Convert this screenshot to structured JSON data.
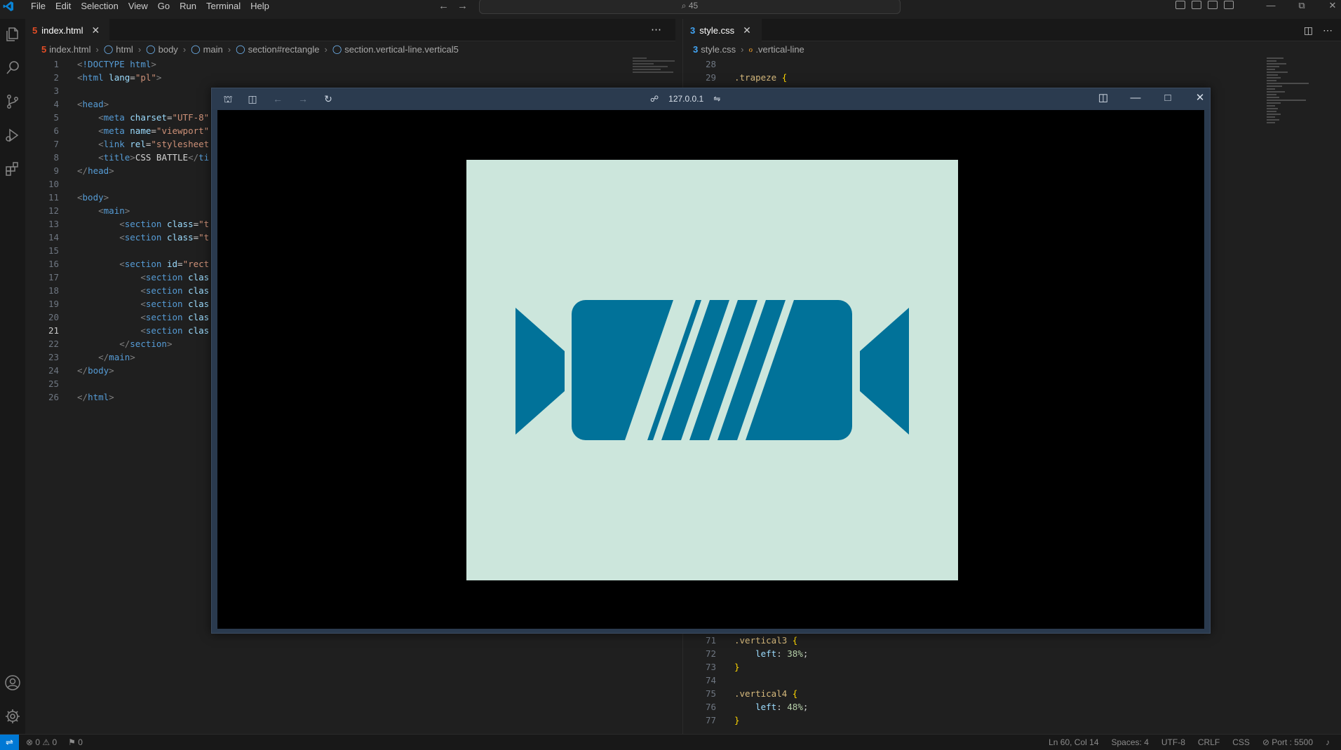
{
  "menu": [
    "File",
    "Edit",
    "Selection",
    "View",
    "Go",
    "Run",
    "Terminal",
    "Help"
  ],
  "command_center": "⌕ 45",
  "left_tab": {
    "label": "index.html"
  },
  "left_breadcrumb": [
    "index.html",
    "html",
    "body",
    "main",
    "section#rectangle",
    "section.vertical-line.vertical5"
  ],
  "left_code": [
    {
      "n": "1",
      "html": "<span class=\"punc\">&lt;</span><span class=\"tag\">!DOCTYPE html</span><span class=\"punc\">&gt;</span>"
    },
    {
      "n": "2",
      "html": "<span class=\"punc\">&lt;</span><span class=\"tag\">html</span> <span class=\"attr\">lang</span>=<span class=\"str\">\"pl\"</span><span class=\"punc\">&gt;</span>"
    },
    {
      "n": "3",
      "html": ""
    },
    {
      "n": "4",
      "html": "<span class=\"punc\">&lt;</span><span class=\"tag\">head</span><span class=\"punc\">&gt;</span>"
    },
    {
      "n": "5",
      "html": "    <span class=\"punc\">&lt;</span><span class=\"tag\">meta</span> <span class=\"attr\">charset</span>=<span class=\"str\">\"UTF-8\"</span>"
    },
    {
      "n": "6",
      "html": "    <span class=\"punc\">&lt;</span><span class=\"tag\">meta</span> <span class=\"attr\">name</span>=<span class=\"str\">\"viewport\"</span>"
    },
    {
      "n": "7",
      "html": "    <span class=\"punc\">&lt;</span><span class=\"tag\">link</span> <span class=\"attr\">rel</span>=<span class=\"str\">\"stylesheet</span>"
    },
    {
      "n": "8",
      "html": "    <span class=\"punc\">&lt;</span><span class=\"tag\">title</span><span class=\"punc\">&gt;</span><span class=\"txt\">CSS BATTLE</span><span class=\"punc\">&lt;/</span><span class=\"tag\">ti</span>"
    },
    {
      "n": "9",
      "html": "<span class=\"punc\">&lt;/</span><span class=\"tag\">head</span><span class=\"punc\">&gt;</span>"
    },
    {
      "n": "10",
      "html": ""
    },
    {
      "n": "11",
      "html": "<span class=\"punc\">&lt;</span><span class=\"tag\">body</span><span class=\"punc\">&gt;</span>"
    },
    {
      "n": "12",
      "html": "    <span class=\"punc\">&lt;</span><span class=\"tag\">main</span><span class=\"punc\">&gt;</span>"
    },
    {
      "n": "13",
      "html": "        <span class=\"punc\">&lt;</span><span class=\"tag\">section</span> <span class=\"attr\">class</span>=<span class=\"str\">\"t</span>"
    },
    {
      "n": "14",
      "html": "        <span class=\"punc\">&lt;</span><span class=\"tag\">section</span> <span class=\"attr\">class</span>=<span class=\"str\">\"t</span>"
    },
    {
      "n": "15",
      "html": ""
    },
    {
      "n": "16",
      "html": "        <span class=\"punc\">&lt;</span><span class=\"tag\">section</span> <span class=\"attr\">id</span>=<span class=\"str\">\"rect</span>"
    },
    {
      "n": "17",
      "html": "            <span class=\"punc\">&lt;</span><span class=\"tag\">section</span> <span class=\"attr\">clas</span>"
    },
    {
      "n": "18",
      "html": "            <span class=\"punc\">&lt;</span><span class=\"tag\">section</span> <span class=\"attr\">clas</span>"
    },
    {
      "n": "19",
      "html": "            <span class=\"punc\">&lt;</span><span class=\"tag\">section</span> <span class=\"attr\">clas</span>"
    },
    {
      "n": "20",
      "html": "            <span class=\"punc\">&lt;</span><span class=\"tag\">section</span> <span class=\"attr\">clas</span>"
    },
    {
      "n": "21",
      "html": "            <span class=\"punc\">&lt;</span><span class=\"tag\">section</span> <span class=\"attr\">clas</span>",
      "active": true
    },
    {
      "n": "22",
      "html": "        <span class=\"punc\">&lt;/</span><span class=\"tag\">section</span><span class=\"punc\">&gt;</span>"
    },
    {
      "n": "23",
      "html": "    <span class=\"punc\">&lt;/</span><span class=\"tag\">main</span><span class=\"punc\">&gt;</span>"
    },
    {
      "n": "24",
      "html": "<span class=\"punc\">&lt;/</span><span class=\"tag\">body</span><span class=\"punc\">&gt;</span>"
    },
    {
      "n": "25",
      "html": ""
    },
    {
      "n": "26",
      "html": "<span class=\"punc\">&lt;/</span><span class=\"tag\">html</span><span class=\"punc\">&gt;</span>"
    }
  ],
  "right_tab": {
    "label": "style.css"
  },
  "right_breadcrumb": [
    "style.css",
    ".vertical-line"
  ],
  "right_code_top": [
    {
      "n": "28",
      "html": ""
    },
    {
      "n": "29",
      "html": "<span class=\"sel\">.trapeze</span> <span class=\"brace\">{</span>"
    }
  ],
  "right_code_bottom": [
    {
      "n": "71",
      "html": "<span class=\"sel\">.vertical3</span> <span class=\"brace\">{</span>"
    },
    {
      "n": "72",
      "html": "    <span class=\"prop\">left</span>: <span class=\"num\">38%</span>;"
    },
    {
      "n": "73",
      "html": "<span class=\"brace\">}</span>"
    },
    {
      "n": "74",
      "html": ""
    },
    {
      "n": "75",
      "html": "<span class=\"sel\">.vertical4</span> <span class=\"brace\">{</span>"
    },
    {
      "n": "76",
      "html": "    <span class=\"prop\">left</span>: <span class=\"num\">48%</span>;"
    },
    {
      "n": "77",
      "html": "<span class=\"brace\">}</span>"
    }
  ],
  "browser": {
    "url": "127.0.0.1",
    "canvas_color": "#cce6dc",
    "shape_color": "#017299",
    "viewport_color": "#000000"
  },
  "status": {
    "problems": "⊗ 0 ⚠ 0",
    "ports_left": "⚑ 0",
    "position": "Ln 60, Col 14",
    "spaces": "Spaces: 4",
    "encoding": "UTF-8",
    "eol": "CRLF",
    "language": "CSS",
    "port": "⊘ Port : 5500"
  },
  "colors": {
    "accent": "#0078d4",
    "html_icon": "#e44d26",
    "css_icon": "#42a5f5"
  }
}
